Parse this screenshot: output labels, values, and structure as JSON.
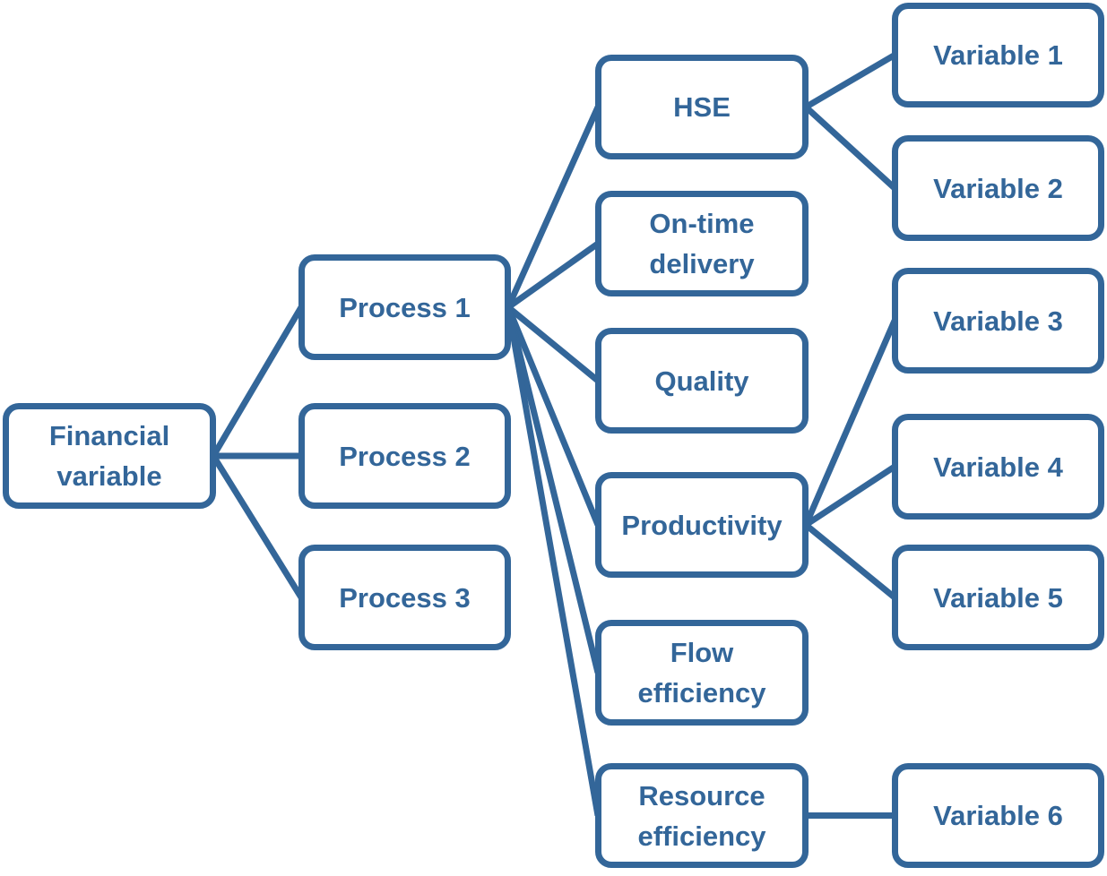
{
  "diagram": {
    "type": "tree",
    "color": "#336699",
    "nodes": [
      {
        "id": "financial-variable",
        "label": "Financial\nvariable"
      },
      {
        "id": "process-1",
        "label": "Process 1"
      },
      {
        "id": "process-2",
        "label": "Process 2"
      },
      {
        "id": "process-3",
        "label": "Process 3"
      },
      {
        "id": "hse",
        "label": "HSE"
      },
      {
        "id": "on-time-delivery",
        "label": "On-time\ndelivery"
      },
      {
        "id": "quality",
        "label": "Quality"
      },
      {
        "id": "productivity",
        "label": "Productivity"
      },
      {
        "id": "flow-efficiency",
        "label": "Flow\nefficiency"
      },
      {
        "id": "resource-efficiency",
        "label": "Resource\nefficiency"
      },
      {
        "id": "variable-1",
        "label": "Variable 1"
      },
      {
        "id": "variable-2",
        "label": "Variable 2"
      },
      {
        "id": "variable-3",
        "label": "Variable 3"
      },
      {
        "id": "variable-4",
        "label": "Variable 4"
      },
      {
        "id": "variable-5",
        "label": "Variable 5"
      },
      {
        "id": "variable-6",
        "label": "Variable 6"
      }
    ],
    "edges": [
      [
        "financial-variable",
        "process-1"
      ],
      [
        "financial-variable",
        "process-2"
      ],
      [
        "financial-variable",
        "process-3"
      ],
      [
        "process-1",
        "hse"
      ],
      [
        "process-1",
        "on-time-delivery"
      ],
      [
        "process-1",
        "quality"
      ],
      [
        "process-1",
        "productivity"
      ],
      [
        "process-1",
        "flow-efficiency"
      ],
      [
        "process-1",
        "resource-efficiency"
      ],
      [
        "hse",
        "variable-1"
      ],
      [
        "hse",
        "variable-2"
      ],
      [
        "productivity",
        "variable-3"
      ],
      [
        "productivity",
        "variable-4"
      ],
      [
        "productivity",
        "variable-5"
      ],
      [
        "resource-efficiency",
        "variable-6"
      ]
    ]
  }
}
